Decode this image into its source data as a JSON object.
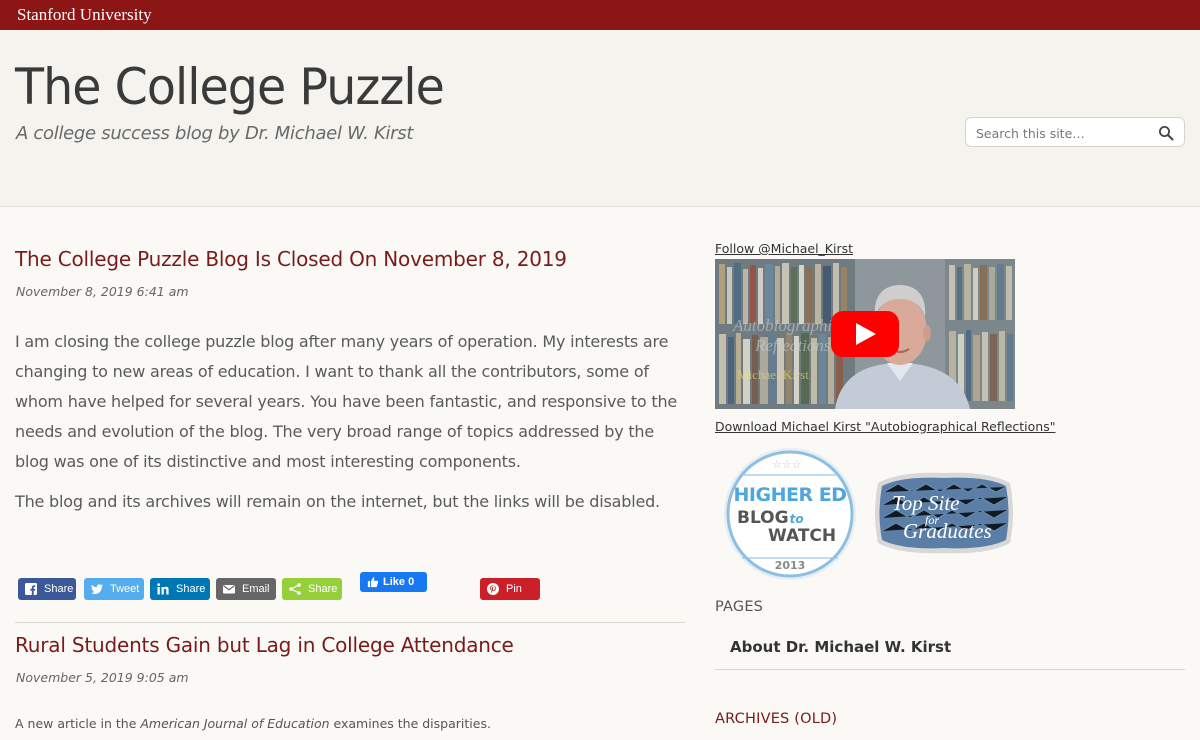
{
  "brand": {
    "name": "Stanford University"
  },
  "header": {
    "site_title": "The College Puzzle",
    "tagline": "A college success blog by Dr. Michael W. Kirst"
  },
  "search": {
    "placeholder": "Search this site…"
  },
  "posts": [
    {
      "title": "The College Puzzle Blog Is Closed On November 8, 2019",
      "date": "November 8, 2019 6:41 am",
      "paragraph1": "I am closing the college puzzle blog after many years of operation. My interests are changing to new areas of education. I want to thank all the contributors, some of whom have helped for several years. You have been fantastic, and responsive to the needs and evolution of the blog. The  very broad range of topics addressed by the blog was one of its distinctive and most interesting components.",
      "paragraph2": "The blog and its archives will remain on the internet, but the links will be disabled."
    },
    {
      "title": "Rural Students Gain but Lag in College Attendance",
      "date": "November 5, 2019 9:05 am",
      "excerpt_before": "A new article in the ",
      "excerpt_italic": "American Journal of Education",
      "excerpt_after": " examines the disparities."
    }
  ],
  "share": {
    "facebook": "Share",
    "twitter": "Tweet",
    "linkedin": "Share",
    "email": "Email",
    "sharethis": "Share",
    "like": "Like 0",
    "pinterest": "Pin",
    "colors": {
      "facebook": "#3b5998",
      "twitter": "#55acee",
      "linkedin": "#0077b5",
      "email": "#666666",
      "sharethis": "#95d03a",
      "pinterest": "#cb2027",
      "like": "#1877f2"
    }
  },
  "sidebar": {
    "follow_link": "Follow @Michael_Kirst",
    "download_link": "Download Michael Kirst \"Autobiographical Reflections\"",
    "badge1": {
      "line1": "HIGHER ED",
      "line2a": "BLOG",
      "line2b": "to",
      "line3": "WATCH",
      "year": "2013"
    },
    "badge2": {
      "line1": "Top Site",
      "line2": "for",
      "line3": "Graduates"
    },
    "pages_heading": "PAGES",
    "pages": [
      "About Dr. Michael W. Kirst"
    ],
    "archives_heading": "ARCHIVES (OLD)"
  },
  "colors": {
    "brand": "#8c1515",
    "post_title": "#7a1a1a"
  }
}
